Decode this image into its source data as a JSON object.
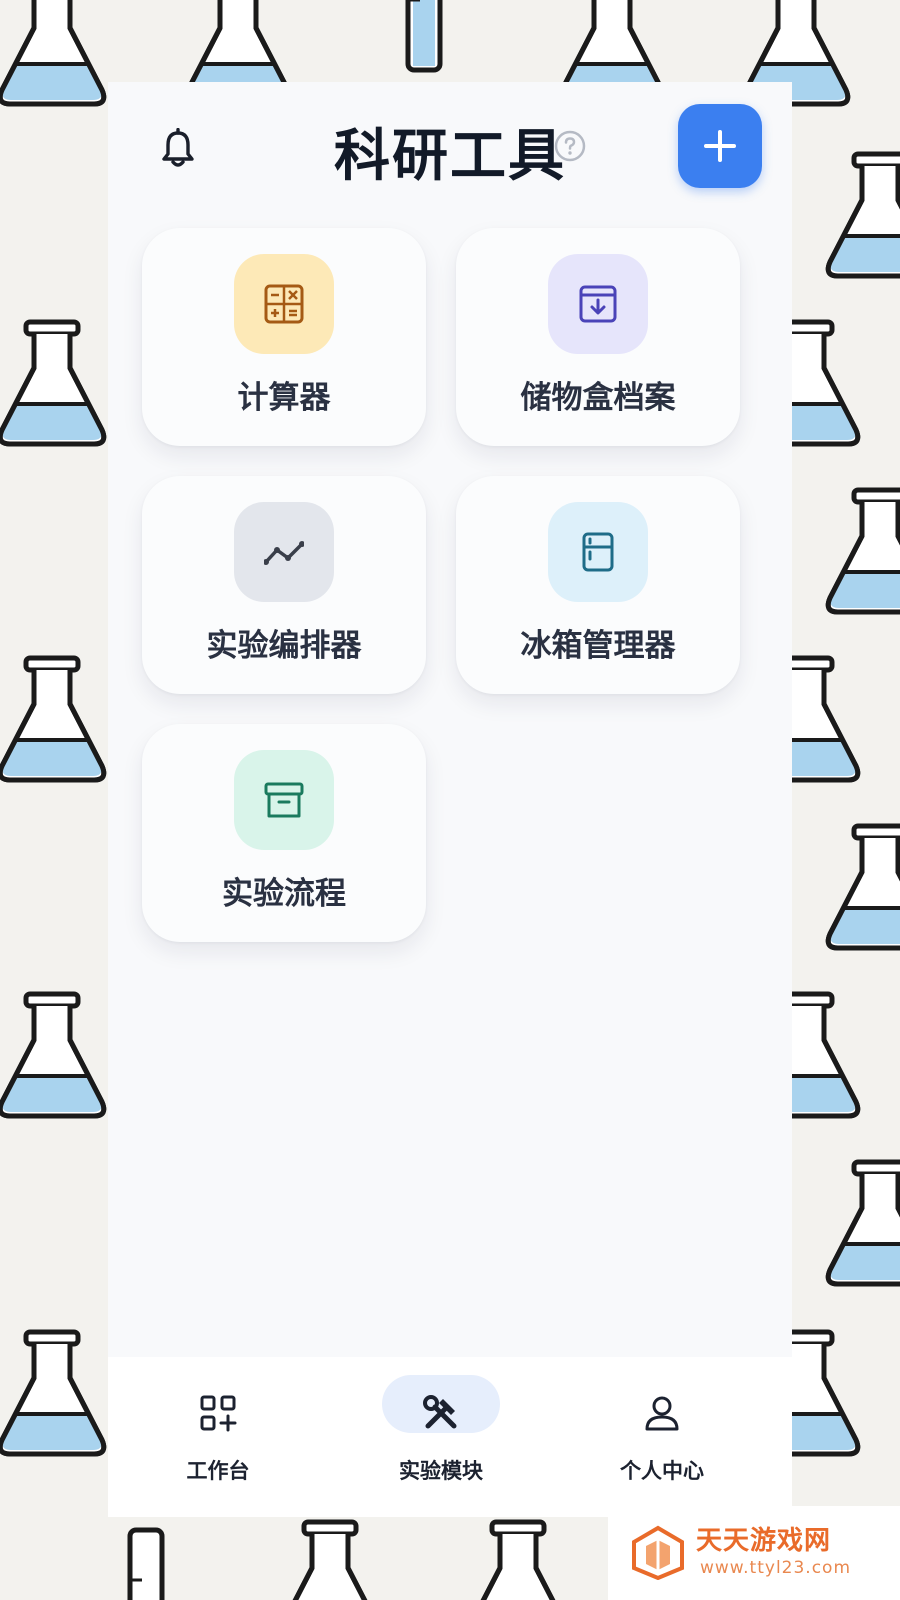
{
  "header": {
    "title": "科研工具",
    "notification_icon": "bell-icon",
    "help_icon": "help-circle-icon",
    "add_icon": "plus-icon"
  },
  "tools": [
    {
      "label": "计算器",
      "icon": "calculator-icon",
      "bg": "#fde9b7",
      "fg": "#a55a14"
    },
    {
      "label": "储物盒档案",
      "icon": "archive-download-icon",
      "bg": "#e6e5fb",
      "fg": "#4a43b8"
    },
    {
      "label": "实验编排器",
      "icon": "line-chart-icon",
      "bg": "#e3e6ec",
      "fg": "#3a3f4a"
    },
    {
      "label": "冰箱管理器",
      "icon": "fridge-icon",
      "bg": "#ddf0fa",
      "fg": "#1e6c88"
    },
    {
      "label": "实验流程",
      "icon": "archive-box-icon",
      "bg": "#d9f4ea",
      "fg": "#1a7a5e"
    }
  ],
  "tabbar": {
    "items": [
      {
        "label": "工作台",
        "icon": "grid-plus-icon"
      },
      {
        "label": "实验模块",
        "icon": "tools-icon",
        "active": true
      },
      {
        "label": "个人中心",
        "icon": "user-icon"
      }
    ]
  },
  "colors": {
    "accent": "#3b7ff0",
    "active_tab_bg": "#e6eefc"
  },
  "watermark": {
    "name": "天天游戏网",
    "url": "www.ttyl23.com"
  }
}
